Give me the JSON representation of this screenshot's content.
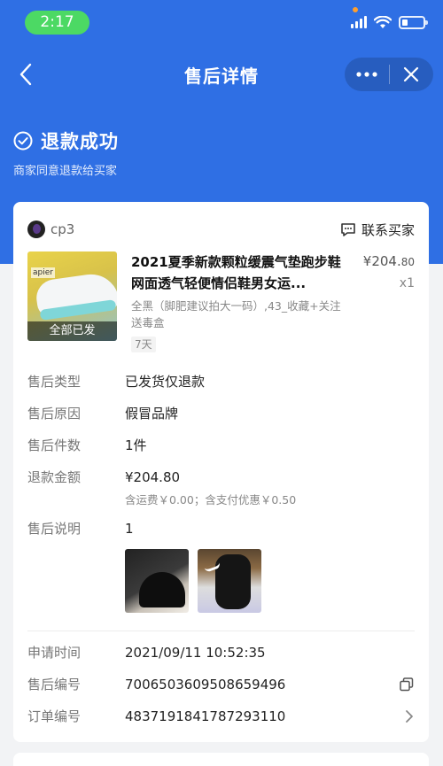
{
  "status_bar": {
    "time": "2:17"
  },
  "nav": {
    "title": "售后详情"
  },
  "status": {
    "title": "退款成功",
    "subtitle": "商家同意退款给买家"
  },
  "shop": {
    "name": "cp3",
    "contact_label": "联系买家"
  },
  "product": {
    "title": "2021夏季新款颗粒缓震气垫跑步鞋网面透气轻便情侣鞋男女运...",
    "spec": "全黑（脚肥建议拍大一码）,43_收藏+关注送毒盒",
    "return_tag": "7天",
    "price_symbol": "¥",
    "price_int": "204.",
    "price_dec": "80",
    "quantity": "x1",
    "image_badge": "全部已发",
    "image_brand": "apier"
  },
  "info": {
    "type": {
      "label": "售后类型",
      "value": "已发货仅退款"
    },
    "reason": {
      "label": "售后原因",
      "value": "假冒品牌"
    },
    "count": {
      "label": "售后件数",
      "value": "1件"
    },
    "amount": {
      "label": "退款金额",
      "value": "¥204.80",
      "note": "含运费￥0.00；含支付优惠￥0.50"
    },
    "desc": {
      "label": "售后说明",
      "value": "1"
    }
  },
  "meta": {
    "apply_time": {
      "label": "申请时间",
      "value": "2021/09/11 10:52:35"
    },
    "aftersale_no": {
      "label": "售后编号",
      "value": "7006503609508659496"
    },
    "order_no": {
      "label": "订单编号",
      "value": "4837191841787293110"
    }
  },
  "colors": {
    "header_blue": "#2f6fe4",
    "time_pill_green": "#4cd964"
  }
}
